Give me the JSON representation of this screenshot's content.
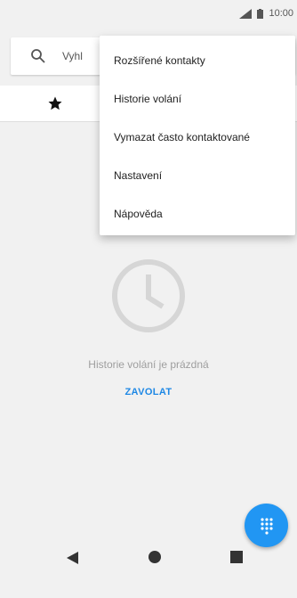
{
  "status_bar": {
    "time": "10:00",
    "icons": [
      "signal-icon",
      "battery-icon"
    ]
  },
  "search": {
    "placeholder": "Vyhl"
  },
  "tabs": [
    {
      "name": "favorites",
      "icon": "star-icon"
    }
  ],
  "menu": {
    "items": [
      {
        "label": "Rozšířené kontakty"
      },
      {
        "label": "Historie volání"
      },
      {
        "label": "Vymazat často kontaktované"
      },
      {
        "label": "Nastavení"
      },
      {
        "label": "Nápověda"
      }
    ]
  },
  "empty_state": {
    "icon": "clock-icon",
    "message": "Historie volání je prázdná",
    "action_label": "ZAVOLAT"
  },
  "fab": {
    "icon": "dialpad-icon",
    "color": "#2196f3"
  },
  "nav": {
    "icons": [
      "back-icon",
      "home-icon",
      "recents-icon"
    ]
  },
  "colors": {
    "accent": "#1e88e5",
    "background": "#f1f1f1",
    "muted_text": "#9e9e9e"
  }
}
